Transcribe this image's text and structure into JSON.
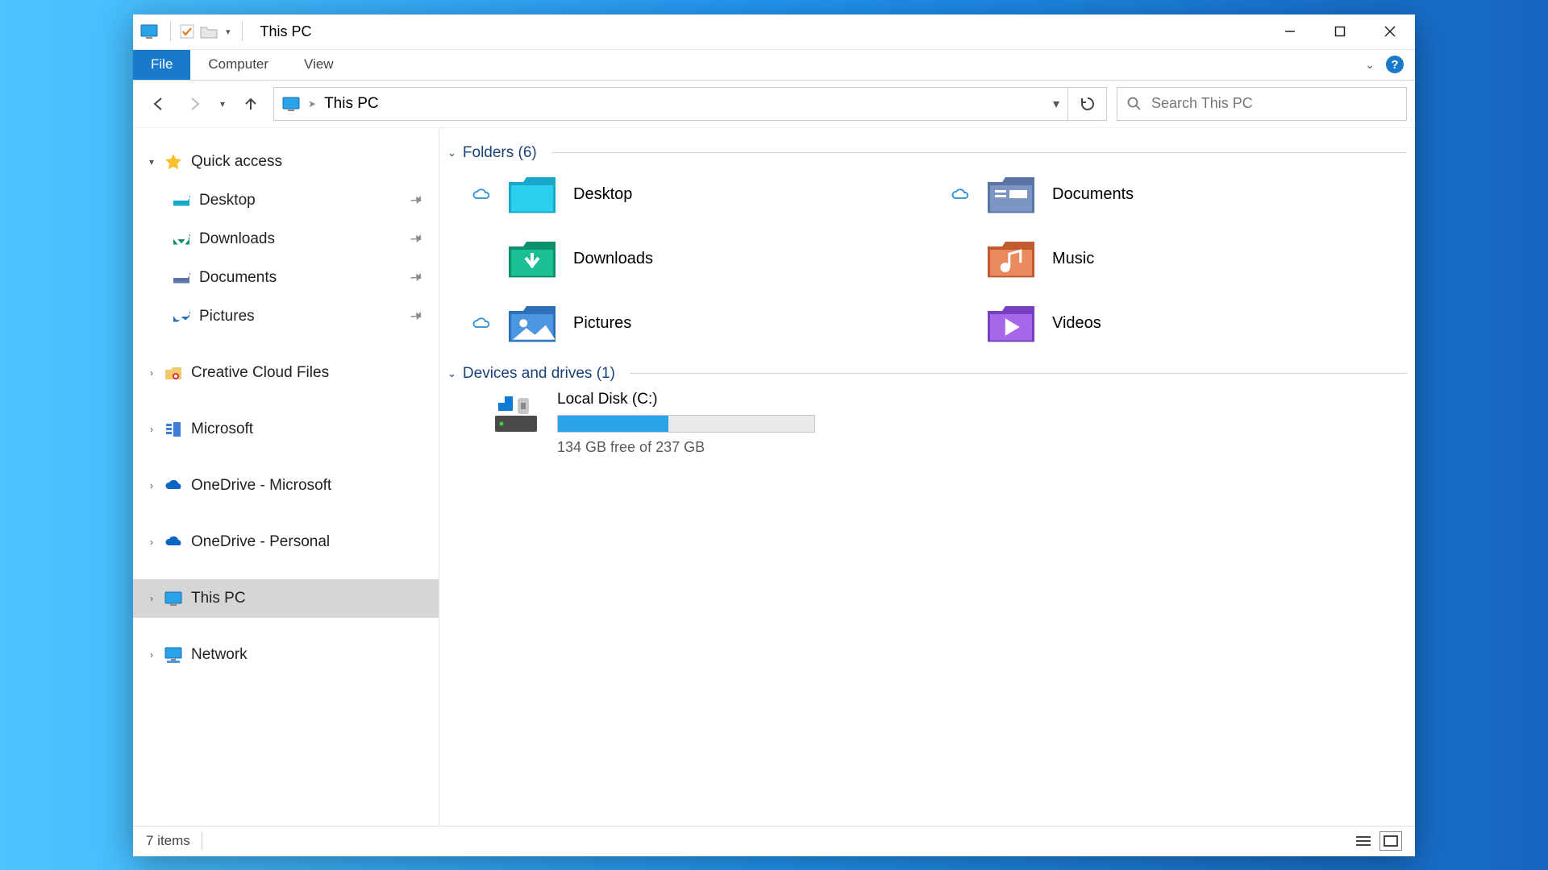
{
  "title": "This PC",
  "ribbon": {
    "file": "File",
    "tabs": [
      "Computer",
      "View"
    ]
  },
  "address": {
    "location": "This PC",
    "search_placeholder": "Search This PC"
  },
  "sidebar": {
    "quick_access": {
      "label": "Quick access",
      "items": [
        {
          "label": "Desktop",
          "icon": "desktop",
          "pinned": true
        },
        {
          "label": "Downloads",
          "icon": "downloads",
          "pinned": true
        },
        {
          "label": "Documents",
          "icon": "documents",
          "pinned": true
        },
        {
          "label": "Pictures",
          "icon": "pictures",
          "pinned": true
        }
      ]
    },
    "roots": [
      {
        "label": "Creative Cloud Files",
        "icon": "cc"
      },
      {
        "label": "Microsoft",
        "icon": "ms"
      },
      {
        "label": "OneDrive - Microsoft",
        "icon": "onedrive"
      },
      {
        "label": "OneDrive - Personal",
        "icon": "onedrive"
      },
      {
        "label": "This PC",
        "icon": "thispc",
        "selected": true
      },
      {
        "label": "Network",
        "icon": "network"
      }
    ]
  },
  "sections": {
    "folders": {
      "header": "Folders (6)",
      "items": [
        {
          "label": "Desktop",
          "icon": "desktop",
          "cloud": true
        },
        {
          "label": "Documents",
          "icon": "documents",
          "cloud": true
        },
        {
          "label": "Downloads",
          "icon": "downloads",
          "cloud": false
        },
        {
          "label": "Music",
          "icon": "music",
          "cloud": false
        },
        {
          "label": "Pictures",
          "icon": "pictures",
          "cloud": true
        },
        {
          "label": "Videos",
          "icon": "videos",
          "cloud": false
        }
      ]
    },
    "drives": {
      "header": "Devices and drives (1)",
      "items": [
        {
          "name": "Local Disk (C:)",
          "free_text": "134 GB free of 237 GB",
          "used_percent": 43
        }
      ]
    }
  },
  "statusbar": {
    "count_text": "7 items"
  }
}
